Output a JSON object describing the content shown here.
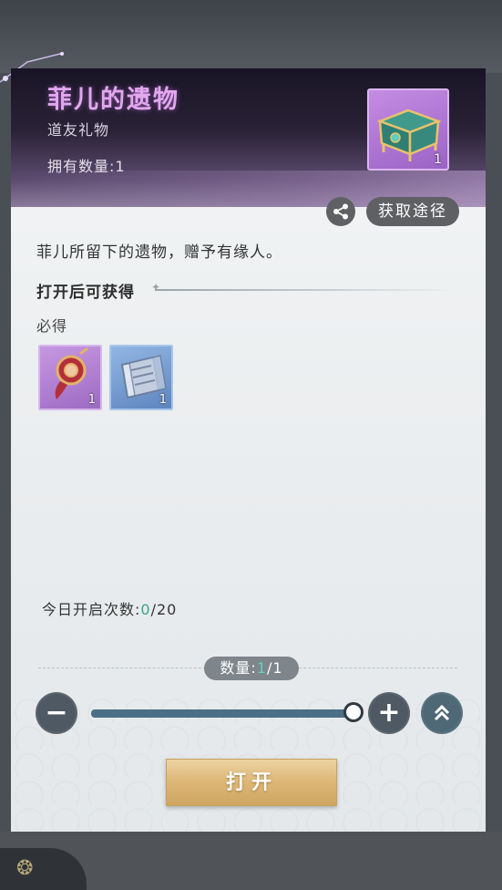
{
  "item": {
    "name": "菲儿的遗物",
    "type": "道友礼物",
    "owned_label": "拥有数量:1",
    "icon_qty": "1"
  },
  "actions": {
    "source_label": "获取途径",
    "open_label": "打开"
  },
  "description": "菲儿所留下的遗物，赠予有缘人。",
  "rewards_section": {
    "title": "打开后可获得",
    "guaranteed_label": "必得",
    "items": [
      {
        "icon": "amulet-icon",
        "qty": "1",
        "rarity": "purple"
      },
      {
        "icon": "scroll-icon",
        "qty": "1",
        "rarity": "blue"
      }
    ]
  },
  "daily_opens": {
    "label": "今日开启次数:",
    "current": "0",
    "max": "/20"
  },
  "quantity": {
    "label": "数量:",
    "current": "1",
    "max": "/1",
    "slider_fraction": 1.0
  },
  "colors": {
    "title_accent": "#e2a7ef",
    "count_accent": "#3aa58f",
    "slider_fill": "#4a6f87"
  }
}
